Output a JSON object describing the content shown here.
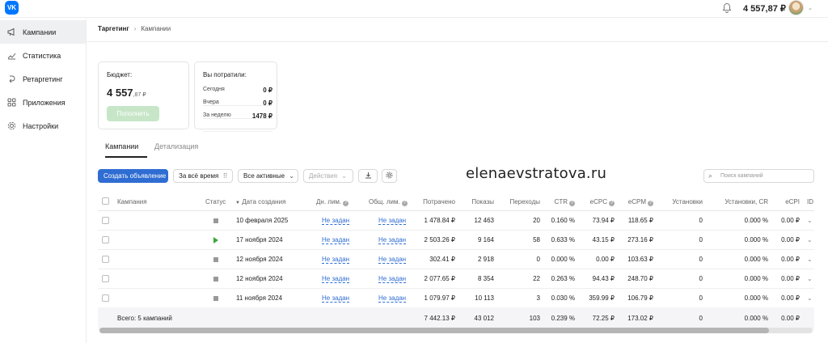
{
  "app": {
    "logo_text": "VK"
  },
  "header": {
    "balance": "4 557,87 ₽"
  },
  "sidebar": {
    "items": [
      {
        "label": "Кампании",
        "icon": "megaphone-icon",
        "active": true
      },
      {
        "label": "Статистика",
        "icon": "chart-icon"
      },
      {
        "label": "Ретаргетинг",
        "icon": "retarget-icon"
      },
      {
        "label": "Приложения",
        "icon": "apps-icon"
      },
      {
        "label": "Настройки",
        "icon": "gear-icon"
      }
    ]
  },
  "breadcrumb": {
    "root": "Таргетинг",
    "sep": "›",
    "current": "Кампании"
  },
  "budget": {
    "label": "Бюджет:",
    "amount_main": "4 557",
    "amount_fraction": ",87 ₽",
    "topup_label": "Пополнить"
  },
  "spent": {
    "label": "Вы потратили:",
    "rows": [
      {
        "label": "Сегодня",
        "value": "0 ₽"
      },
      {
        "label": "Вчера",
        "value": "0 ₽"
      },
      {
        "label": "За неделю",
        "value": "1478 ₽"
      }
    ]
  },
  "tabs": [
    {
      "label": "Кампании",
      "active": true
    },
    {
      "label": "Детализация"
    }
  ],
  "toolbar": {
    "create_label": "Создать объявление",
    "period_label": "За всё время",
    "filter_label": "Все активные",
    "actions_label": "Действия",
    "search_placeholder": "Поиск кампаний"
  },
  "watermark": "elenaevstratova.ru",
  "table": {
    "headers": {
      "campaign": "Кампания",
      "status": "Статус",
      "created": "Дата создания",
      "day_limit": "Дн. лим.",
      "total_limit": "Общ. лим.",
      "spent": "Потрачено",
      "impressions": "Показы",
      "clicks": "Переходы",
      "ctr": "CTR",
      "ecpc": "eCPC",
      "ecpm": "eCPM",
      "installs": "Установки",
      "installs_cr": "Установки, CR",
      "ecpi": "eCPI",
      "id": "ID"
    },
    "rows": [
      {
        "status": "stopped",
        "created": "10 февраля 2025",
        "day_limit": "Не задан",
        "total_limit": "Не задан",
        "spent": "1 478.84 ₽",
        "impressions": "12 463",
        "clicks": "20",
        "ctr": "0.160 %",
        "ecpc": "73.94 ₽",
        "ecpm": "118.65 ₽",
        "installs": "0",
        "installs_cr": "0.000 %",
        "ecpi": "0.00 ₽"
      },
      {
        "status": "active",
        "created": "17 ноября 2024",
        "day_limit": "Не задан",
        "total_limit": "Не задан",
        "spent": "2 503.26 ₽",
        "impressions": "9 164",
        "clicks": "58",
        "ctr": "0.633 %",
        "ecpc": "43.15 ₽",
        "ecpm": "273.16 ₽",
        "installs": "0",
        "installs_cr": "0.000 %",
        "ecpi": "0.00 ₽"
      },
      {
        "status": "stopped",
        "created": "12 ноября 2024",
        "day_limit": "Не задан",
        "total_limit": "Не задан",
        "spent": "302.41 ₽",
        "impressions": "2 918",
        "clicks": "0",
        "ctr": "0.000 %",
        "ecpc": "0.00 ₽",
        "ecpm": "103.63 ₽",
        "installs": "0",
        "installs_cr": "0.000 %",
        "ecpi": "0.00 ₽"
      },
      {
        "status": "stopped",
        "created": "12 ноября 2024",
        "day_limit": "Не задан",
        "total_limit": "Не задан",
        "spent": "2 077.65 ₽",
        "impressions": "8 354",
        "clicks": "22",
        "ctr": "0.263 %",
        "ecpc": "94.43 ₽",
        "ecpm": "248.70 ₽",
        "installs": "0",
        "installs_cr": "0.000 %",
        "ecpi": "0.00 ₽"
      },
      {
        "status": "stopped",
        "created": "11 ноября 2024",
        "day_limit": "Не задан",
        "total_limit": "Не задан",
        "spent": "1 079.97 ₽",
        "impressions": "10 113",
        "clicks": "3",
        "ctr": "0.030 %",
        "ecpc": "359.99 ₽",
        "ecpm": "106.79 ₽",
        "installs": "0",
        "installs_cr": "0.000 %",
        "ecpi": "0.00 ₽"
      }
    ],
    "totals": {
      "label": "Всего: 5 кампаний",
      "spent": "7 442.13 ₽",
      "impressions": "43 012",
      "clicks": "103",
      "ctr": "0.239 %",
      "ecpc": "72.25 ₽",
      "ecpm": "173.02 ₽",
      "installs": "0",
      "installs_cr": "0.000 %",
      "ecpi": "0.00 ₽"
    }
  },
  "colors": {
    "accent": "#2f6dd2",
    "brand": "#0077ff",
    "active_status": "#3aa63a",
    "topup_disabled": "#c7e6c8"
  }
}
